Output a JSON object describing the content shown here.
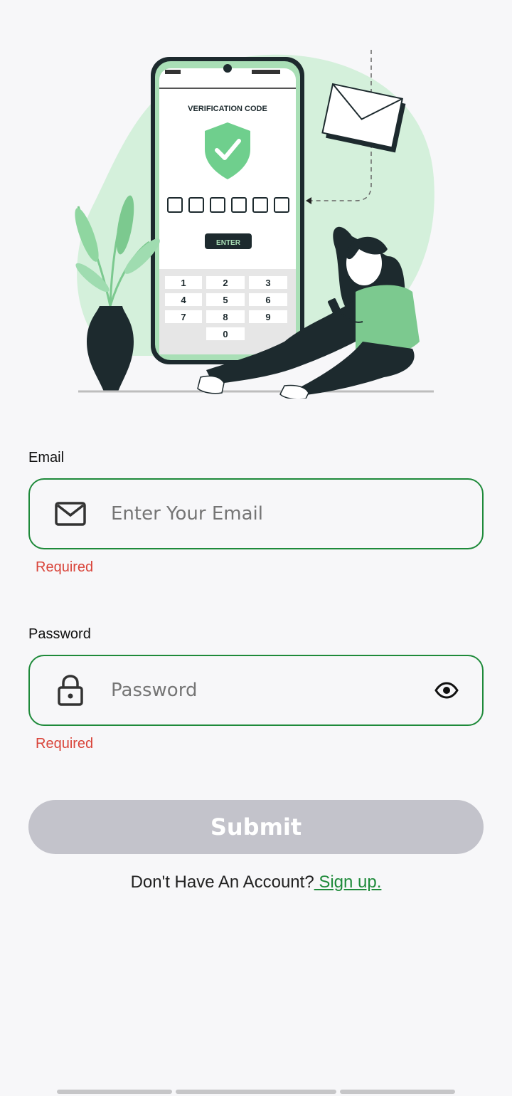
{
  "illustration": {
    "phone_header": "VERIFICATION CODE",
    "enter_label": "ENTER",
    "keypad": [
      "1",
      "2",
      "3",
      "4",
      "5",
      "6",
      "7",
      "8",
      "9",
      "0"
    ]
  },
  "email": {
    "label": "Email",
    "placeholder": "Enter Your Email",
    "error": "Required"
  },
  "password": {
    "label": "Password",
    "placeholder": "Password",
    "error": "Required"
  },
  "submit": {
    "label": "Submit"
  },
  "signup": {
    "prompt": "Don't Have An Account?",
    "link": " Sign up."
  },
  "colors": {
    "accent": "#1e8a3a",
    "error": "#d9443a",
    "button_disabled": "#c3c3cb",
    "background": "#f7f7f9"
  }
}
